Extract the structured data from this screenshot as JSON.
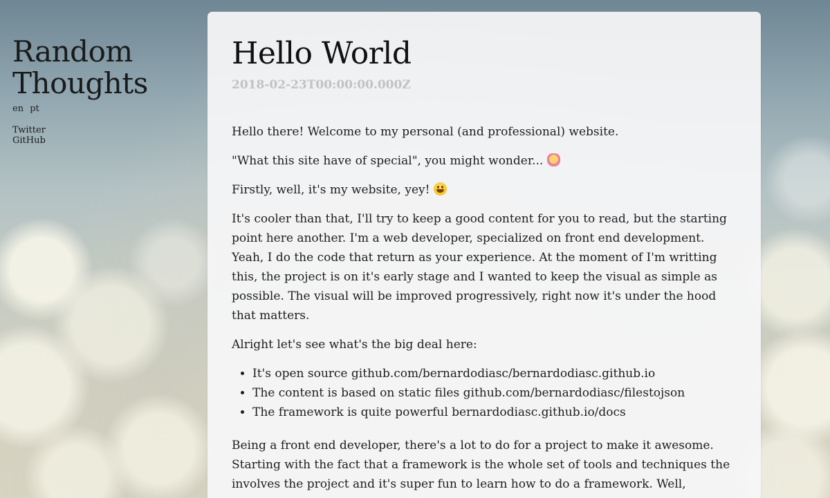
{
  "sidebar": {
    "title_line1": "Random",
    "title_line2": "Thoughts",
    "languages": [
      "en",
      "pt"
    ],
    "social": [
      "Twitter",
      "GitHub"
    ]
  },
  "post": {
    "title": "Hello World",
    "date": "2018-02-23T00:00:00.000Z",
    "p1": "Hello there! Welcome to my personal (and professional) website.",
    "p2": "\"What this site have of special\", you might wonder...",
    "p2_emoji": "raising-hand-emoji",
    "p3": "Firstly, well, it's my website, yey!",
    "p3_emoji": "smiley-emoji",
    "p4": "It's cooler than that, I'll try to keep a good content for you to read, but the starting point here another. I'm a web developer, specialized on front end development. Yeah, I do the code that return as your experience. At the moment of I'm writting this, the project is on it's early stage and I wanted to keep the visual as simple as possible. The visual will be improved progressively, right now it's under the hood that matters.",
    "p5": "Alright let's see what's the big deal here:",
    "list": [
      {
        "text": "It's open source ",
        "link": "github.com/bernardodiasc/bernardodiasc.github.io"
      },
      {
        "text": "The content is based on static files ",
        "link": "github.com/bernardodiasc/filestojson"
      },
      {
        "text": "The framework is quite powerful ",
        "link": "bernardodiasc.github.io/docs"
      }
    ],
    "p6": "Being a front end developer, there's a lot to do for a project to make it awesome. Starting with the fact that a framework is the whole set of tools and techniques the involves the project and it's super fun to learn how to do a framework. Well,"
  }
}
